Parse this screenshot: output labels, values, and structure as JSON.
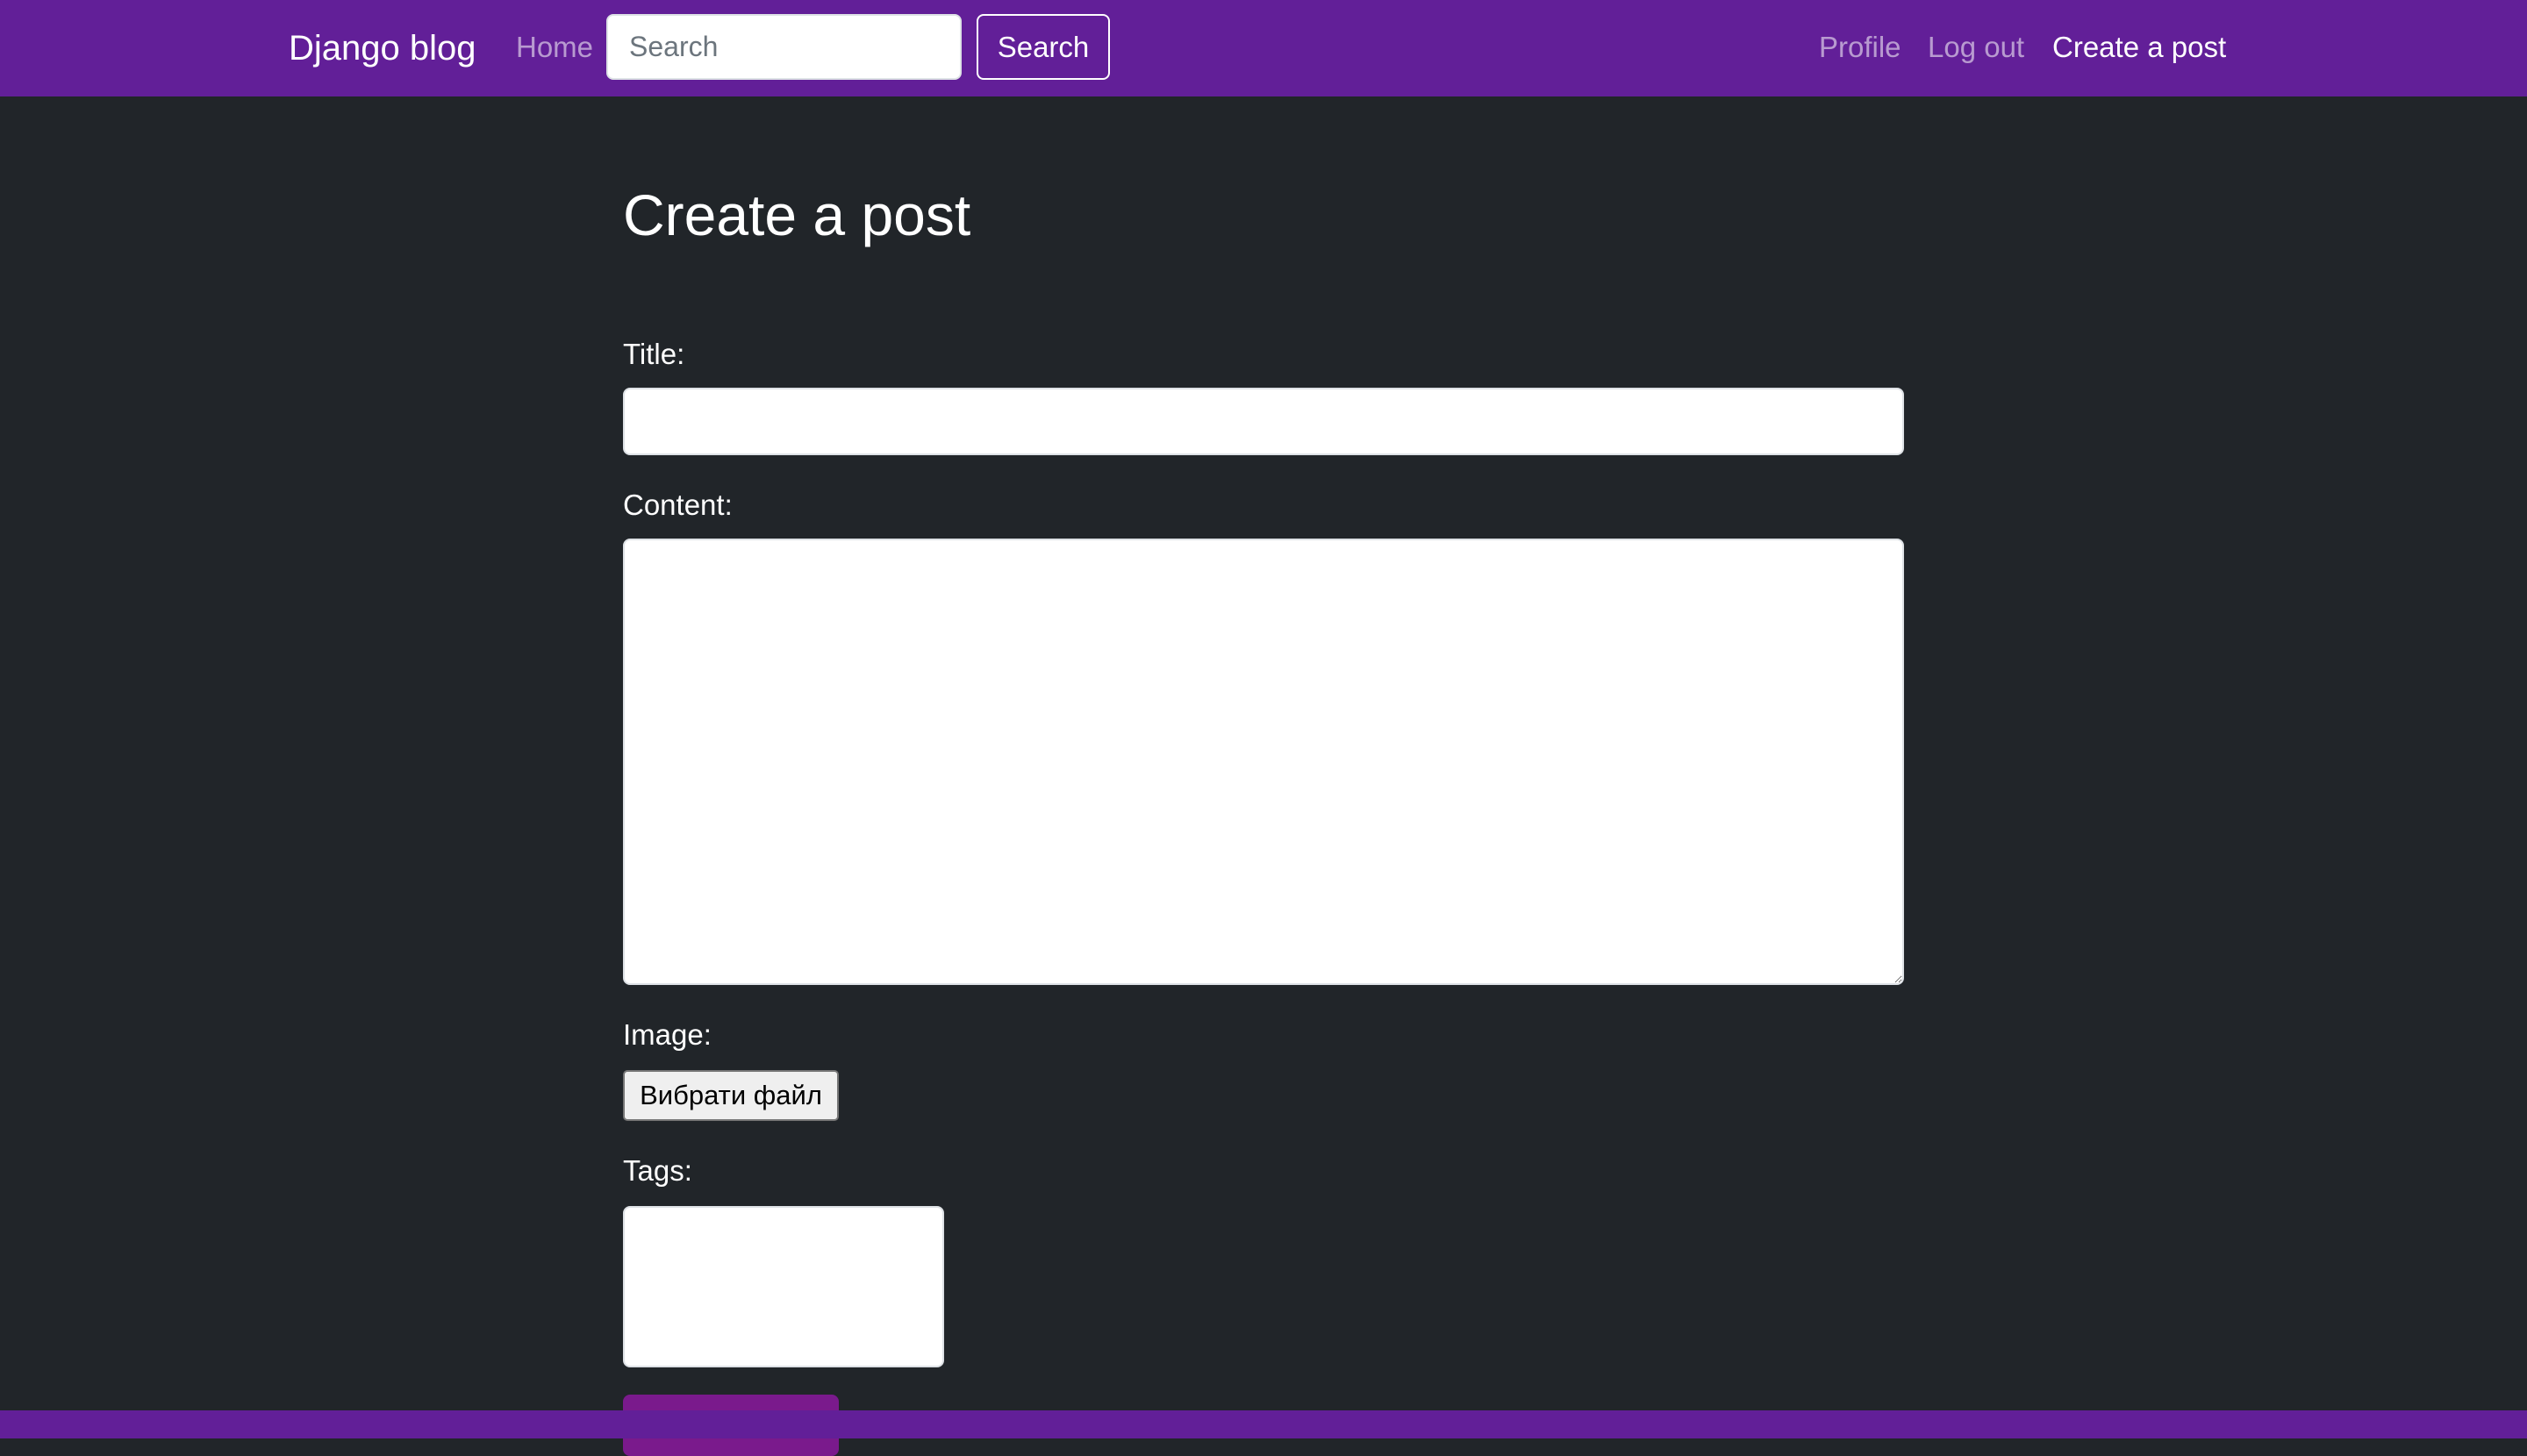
{
  "navbar": {
    "brand": "Django blog",
    "home_label": "Home",
    "search_placeholder": "Search",
    "search_button_label": "Search",
    "profile_label": "Profile",
    "logout_label": "Log out",
    "create_post_label": "Create a post",
    "background_color": "#621f98"
  },
  "main": {
    "page_title": "Create a post",
    "form": {
      "title_label": "Title:",
      "title_value": "",
      "content_label": "Content:",
      "content_value": "",
      "image_label": "Image:",
      "image_button_label": "Вибрати файл",
      "tags_label": "Tags:",
      "tags_options": []
    }
  },
  "colors": {
    "page_background": "#212529",
    "accent": "#621f98",
    "submit_button": "#7a1a8c"
  }
}
